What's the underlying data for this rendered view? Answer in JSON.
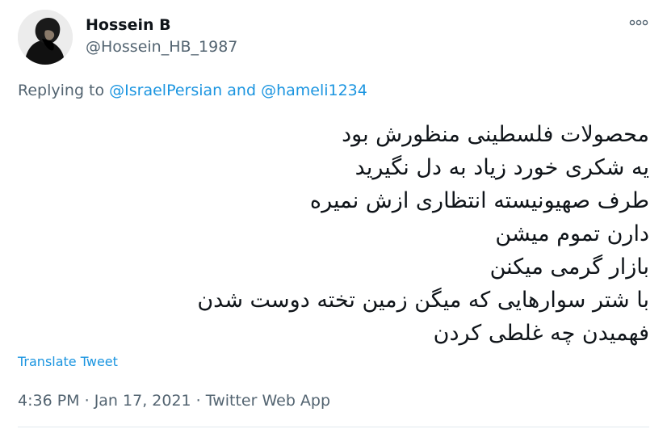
{
  "author": {
    "display_name": "Hossein B",
    "handle": "@Hossein_HB_1987"
  },
  "more_icon": "more-horizontal-icon",
  "reply": {
    "prefix": "Replying to ",
    "mention1": "@IsraelPersian",
    "and": " and ",
    "mention2": "@hameli1234"
  },
  "tweet_lines": [
    "محصولات فلسطینی منظورش بود",
    "یه شکری خورد زیاد به دل نگیرید",
    "طرف صهیونیسته انتظاری ازش نمیره",
    "دارن تموم میشن",
    "بازار گرمی میکنن",
    "با شتر سوارهایی که میگن زمین تخته دوست شدن",
    "فهمیدن چه غلطی کردن"
  ],
  "translate_label": "Translate Tweet",
  "meta": {
    "time": "4:36 PM",
    "sep1": " · ",
    "date": "Jan 17, 2021",
    "sep2": " · ",
    "app": "Twitter Web App"
  },
  "colors": {
    "link": "#1b95e0",
    "secondary": "#536471",
    "text": "#0f1419"
  }
}
